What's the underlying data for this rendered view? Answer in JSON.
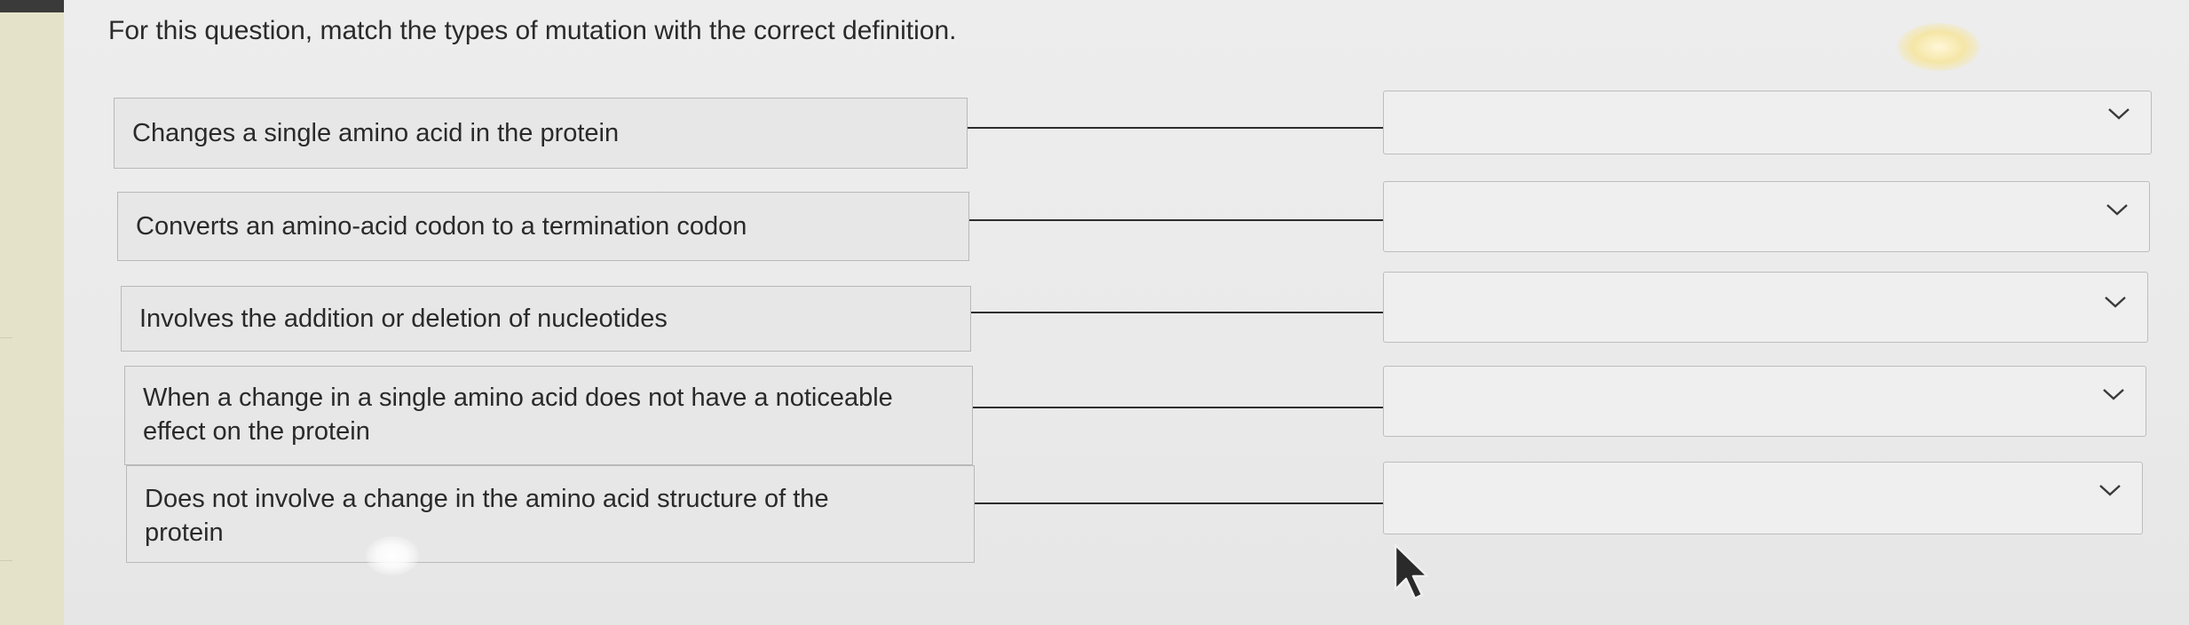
{
  "question": {
    "text": "For this question, match the types of mutation with the correct definition."
  },
  "rows": [
    {
      "definition": "Changes a single amino acid in the protein",
      "selected_value": ""
    },
    {
      "definition": "Converts an amino-acid codon to a termination codon",
      "selected_value": ""
    },
    {
      "definition": "Involves the addition or deletion of nucleotides",
      "selected_value": ""
    },
    {
      "definition": "When a change in a single amino acid does not have a noticeable effect on the protein",
      "selected_value": ""
    },
    {
      "definition": "Does not involve a change in the amino acid structure of the protein",
      "selected_value": ""
    }
  ],
  "icons": {
    "dropdown": "chevron-down-icon",
    "cursor": "mouse-pointer-icon"
  },
  "colors": {
    "label_background": "#e7e7e7",
    "border": "#b9b9b9",
    "connector": "#2d2d2d",
    "text": "#2a2a2a"
  }
}
